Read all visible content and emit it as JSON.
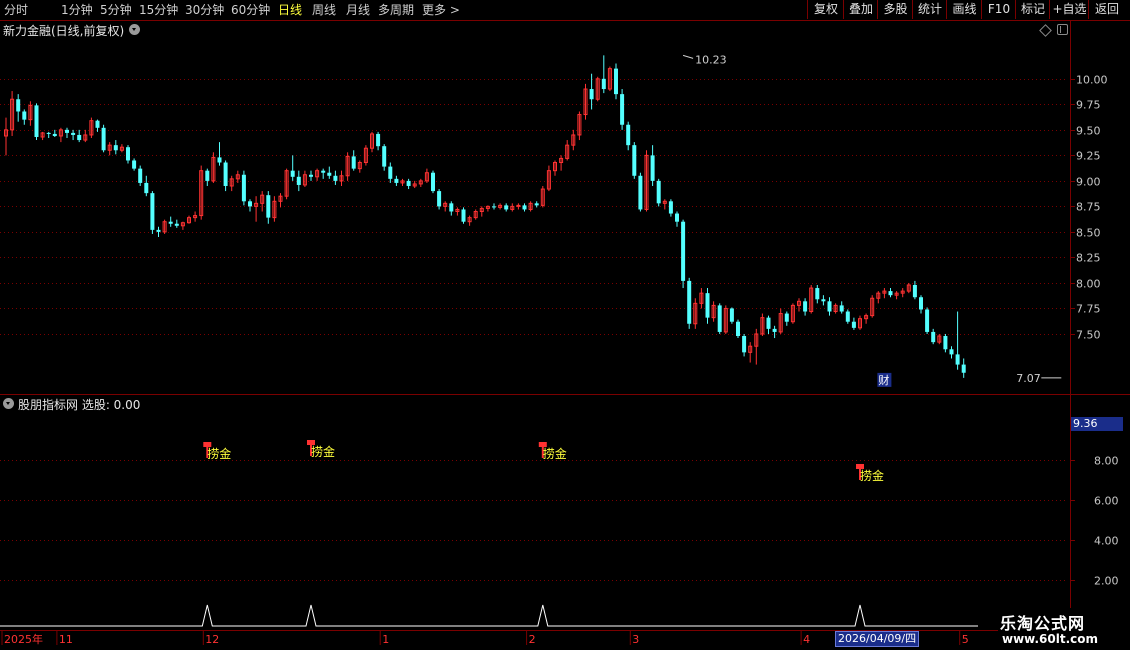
{
  "toolbar": {
    "periods": [
      "分时",
      "1分钟",
      "5分钟",
      "15分钟",
      "30分钟",
      "60分钟",
      "日线",
      "周线",
      "月线",
      "多周期",
      "更多 >"
    ],
    "active_period": "日线",
    "buttons": [
      "复权",
      "叠加",
      "多股",
      "统计",
      "画线",
      "F10",
      "标记",
      "+自选",
      "返回"
    ]
  },
  "price_panel": {
    "title": "新力金融(日线,前复权)"
  },
  "indicator_panel": {
    "title": "股朋指标网  选股: 0.00",
    "highlight_value": "9.36"
  },
  "brand": {
    "name": "乐淘公式网",
    "url": "www.60lt.com"
  },
  "colors": {
    "up": "#ff3232",
    "down": "#54ffff",
    "grid": "#7a0000",
    "axis_text": "#c8c8c8",
    "signal_text": "#ffff3c",
    "spike": "#ffffff"
  },
  "chart_data": [
    {
      "type": "candlestick",
      "ylim": [
        7.0,
        10.4
      ],
      "yticks": [
        7.5,
        7.75,
        8.0,
        8.25,
        8.5,
        8.75,
        9.0,
        9.25,
        9.5,
        9.75,
        10.0
      ],
      "annotations": [
        {
          "label": "10.23",
          "bar": 111,
          "value": 10.23
        },
        {
          "label": "7.07",
          "bar": 173,
          "value": 7.07
        },
        {
          "label": "财",
          "bar": 144,
          "value": 7.05
        }
      ],
      "candles": [
        [
          9.44,
          9.62,
          9.25,
          9.5
        ],
        [
          9.5,
          9.88,
          9.44,
          9.8
        ],
        [
          9.8,
          9.85,
          9.58,
          9.68
        ],
        [
          9.68,
          9.7,
          9.55,
          9.6
        ],
        [
          9.6,
          9.78,
          9.54,
          9.74
        ],
        [
          9.74,
          9.76,
          9.4,
          9.43
        ],
        [
          9.43,
          9.48,
          9.4,
          9.47
        ],
        [
          9.47,
          9.48,
          9.42,
          9.46
        ],
        [
          9.46,
          9.5,
          9.43,
          9.44
        ],
        [
          9.44,
          9.52,
          9.38,
          9.5
        ],
        [
          9.5,
          9.52,
          9.42,
          9.47
        ],
        [
          9.47,
          9.5,
          9.4,
          9.45
        ],
        [
          9.45,
          9.5,
          9.38,
          9.4
        ],
        [
          9.4,
          9.5,
          9.38,
          9.45
        ],
        [
          9.45,
          9.62,
          9.42,
          9.59
        ],
        [
          9.59,
          9.6,
          9.48,
          9.52
        ],
        [
          9.52,
          9.55,
          9.28,
          9.3
        ],
        [
          9.3,
          9.38,
          9.25,
          9.35
        ],
        [
          9.35,
          9.4,
          9.26,
          9.3
        ],
        [
          9.3,
          9.36,
          9.28,
          9.33
        ],
        [
          9.33,
          9.35,
          9.17,
          9.2
        ],
        [
          9.2,
          9.22,
          9.1,
          9.12
        ],
        [
          9.12,
          9.15,
          8.95,
          8.98
        ],
        [
          8.98,
          9.05,
          8.85,
          8.88
        ],
        [
          8.88,
          8.9,
          8.48,
          8.52
        ],
        [
          8.52,
          8.55,
          8.45,
          8.5
        ],
        [
          8.5,
          8.62,
          8.48,
          8.6
        ],
        [
          8.6,
          8.65,
          8.55,
          8.58
        ],
        [
          8.58,
          8.62,
          8.54,
          8.56
        ],
        [
          8.56,
          8.6,
          8.52,
          8.59
        ],
        [
          8.59,
          8.66,
          8.58,
          8.64
        ],
        [
          8.64,
          8.7,
          8.6,
          8.66
        ],
        [
          8.66,
          9.15,
          8.62,
          9.1
        ],
        [
          9.1,
          9.12,
          8.95,
          9.0
        ],
        [
          9.0,
          9.28,
          8.98,
          9.23
        ],
        [
          9.23,
          9.38,
          9.15,
          9.18
        ],
        [
          9.18,
          9.2,
          8.9,
          8.95
        ],
        [
          8.95,
          9.05,
          8.9,
          9.02
        ],
        [
          9.02,
          9.1,
          8.98,
          9.06
        ],
        [
          9.06,
          9.1,
          8.76,
          8.8
        ],
        [
          8.8,
          8.82,
          8.7,
          8.75
        ],
        [
          8.75,
          8.85,
          8.6,
          8.78
        ],
        [
          8.78,
          8.9,
          8.7,
          8.86
        ],
        [
          8.86,
          8.9,
          8.58,
          8.64
        ],
        [
          8.64,
          8.85,
          8.6,
          8.8
        ],
        [
          8.8,
          8.88,
          8.74,
          8.85
        ],
        [
          8.85,
          9.12,
          8.82,
          9.1
        ],
        [
          9.1,
          9.25,
          9.0,
          9.04
        ],
        [
          9.04,
          9.1,
          8.9,
          8.96
        ],
        [
          8.96,
          9.1,
          8.94,
          9.06
        ],
        [
          9.06,
          9.1,
          9.0,
          9.04
        ],
        [
          9.04,
          9.12,
          9.0,
          9.1
        ],
        [
          9.1,
          9.12,
          9.02,
          9.08
        ],
        [
          9.08,
          9.14,
          9.02,
          9.05
        ],
        [
          9.05,
          9.1,
          8.96,
          9.0
        ],
        [
          9.0,
          9.1,
          8.95,
          9.05
        ],
        [
          9.05,
          9.28,
          9.0,
          9.24
        ],
        [
          9.24,
          9.3,
          9.1,
          9.12
        ],
        [
          9.12,
          9.2,
          9.08,
          9.18
        ],
        [
          9.18,
          9.35,
          9.15,
          9.32
        ],
        [
          9.32,
          9.48,
          9.28,
          9.46
        ],
        [
          9.46,
          9.48,
          9.3,
          9.34
        ],
        [
          9.34,
          9.36,
          9.1,
          9.14
        ],
        [
          9.14,
          9.18,
          8.98,
          9.02
        ],
        [
          9.02,
          9.05,
          8.95,
          8.98
        ],
        [
          8.98,
          9.02,
          8.95,
          9.0
        ],
        [
          9.0,
          9.02,
          8.92,
          8.95
        ],
        [
          8.95,
          9.0,
          8.93,
          8.97
        ],
        [
          8.97,
          9.02,
          8.94,
          9.0
        ],
        [
          9.0,
          9.12,
          8.98,
          9.08
        ],
        [
          9.08,
          9.1,
          8.88,
          8.9
        ],
        [
          8.9,
          8.92,
          8.72,
          8.75
        ],
        [
          8.75,
          8.8,
          8.7,
          8.78
        ],
        [
          8.78,
          8.8,
          8.66,
          8.7
        ],
        [
          8.7,
          8.74,
          8.66,
          8.72
        ],
        [
          8.72,
          8.74,
          8.58,
          8.6
        ],
        [
          8.6,
          8.66,
          8.56,
          8.64
        ],
        [
          8.64,
          8.72,
          8.62,
          8.7
        ],
        [
          8.7,
          8.75,
          8.65,
          8.73
        ],
        [
          8.73,
          8.76,
          8.7,
          8.75
        ],
        [
          8.75,
          8.78,
          8.72,
          8.74
        ],
        [
          8.74,
          8.78,
          8.72,
          8.76
        ],
        [
          8.76,
          8.78,
          8.7,
          8.72
        ],
        [
          8.72,
          8.78,
          8.7,
          8.75
        ],
        [
          8.75,
          8.78,
          8.72,
          8.76
        ],
        [
          8.76,
          8.78,
          8.7,
          8.72
        ],
        [
          8.72,
          8.8,
          8.7,
          8.78
        ],
        [
          8.78,
          8.8,
          8.74,
          8.76
        ],
        [
          8.76,
          8.95,
          8.74,
          8.92
        ],
        [
          8.92,
          9.15,
          8.9,
          9.1
        ],
        [
          9.1,
          9.2,
          9.05,
          9.18
        ],
        [
          9.18,
          9.25,
          9.1,
          9.22
        ],
        [
          9.22,
          9.4,
          9.2,
          9.35
        ],
        [
          9.35,
          9.5,
          9.3,
          9.45
        ],
        [
          9.45,
          9.68,
          9.4,
          9.65
        ],
        [
          9.65,
          9.95,
          9.6,
          9.9
        ],
        [
          9.9,
          10.05,
          9.7,
          9.8
        ],
        [
          9.8,
          10.02,
          9.78,
          10.0
        ],
        [
          10.0,
          10.23,
          9.86,
          9.9
        ],
        [
          9.9,
          10.12,
          9.88,
          10.1
        ],
        [
          10.1,
          10.15,
          9.8,
          9.85
        ],
        [
          9.85,
          9.9,
          9.5,
          9.55
        ],
        [
          9.55,
          9.58,
          9.3,
          9.35
        ],
        [
          9.35,
          9.38,
          9.02,
          9.05
        ],
        [
          9.05,
          9.08,
          8.7,
          8.72
        ],
        [
          8.72,
          9.3,
          8.7,
          9.25
        ],
        [
          9.25,
          9.35,
          8.95,
          9.0
        ],
        [
          9.0,
          9.02,
          8.75,
          8.78
        ],
        [
          8.78,
          8.82,
          8.72,
          8.8
        ],
        [
          8.8,
          8.82,
          8.65,
          8.68
        ],
        [
          8.68,
          8.7,
          8.55,
          8.6
        ],
        [
          8.6,
          8.62,
          7.95,
          8.02
        ],
        [
          8.02,
          8.05,
          7.55,
          7.6
        ],
        [
          7.6,
          7.85,
          7.55,
          7.8
        ],
        [
          7.8,
          7.95,
          7.75,
          7.9
        ],
        [
          7.9,
          7.95,
          7.6,
          7.66
        ],
        [
          7.66,
          7.82,
          7.62,
          7.78
        ],
        [
          7.78,
          7.8,
          7.5,
          7.52
        ],
        [
          7.52,
          7.78,
          7.5,
          7.75
        ],
        [
          7.75,
          7.76,
          7.6,
          7.62
        ],
        [
          7.62,
          7.64,
          7.46,
          7.48
        ],
        [
          7.48,
          7.5,
          7.28,
          7.32
        ],
        [
          7.32,
          7.42,
          7.22,
          7.38
        ],
        [
          7.38,
          7.55,
          7.2,
          7.5
        ],
        [
          7.5,
          7.7,
          7.48,
          7.66
        ],
        [
          7.66,
          7.68,
          7.5,
          7.55
        ],
        [
          7.55,
          7.58,
          7.46,
          7.52
        ],
        [
          7.52,
          7.75,
          7.5,
          7.7
        ],
        [
          7.7,
          7.72,
          7.58,
          7.62
        ],
        [
          7.62,
          7.8,
          7.6,
          7.78
        ],
        [
          7.78,
          7.85,
          7.72,
          7.82
        ],
        [
          7.82,
          7.85,
          7.68,
          7.72
        ],
        [
          7.72,
          7.98,
          7.7,
          7.95
        ],
        [
          7.95,
          7.98,
          7.8,
          7.84
        ],
        [
          7.84,
          7.88,
          7.78,
          7.82
        ],
        [
          7.82,
          7.86,
          7.68,
          7.72
        ],
        [
          7.72,
          7.8,
          7.7,
          7.78
        ],
        [
          7.78,
          7.82,
          7.7,
          7.72
        ],
        [
          7.72,
          7.74,
          7.6,
          7.62
        ],
        [
          7.62,
          7.66,
          7.54,
          7.56
        ],
        [
          7.56,
          7.68,
          7.54,
          7.65
        ],
        [
          7.65,
          7.7,
          7.6,
          7.68
        ],
        [
          7.68,
          7.88,
          7.66,
          7.85
        ],
        [
          7.85,
          7.92,
          7.8,
          7.9
        ],
        [
          7.9,
          7.95,
          7.85,
          7.92
        ],
        [
          7.92,
          7.95,
          7.86,
          7.88
        ],
        [
          7.88,
          7.92,
          7.84,
          7.9
        ],
        [
          7.9,
          7.95,
          7.86,
          7.92
        ],
        [
          7.92,
          8.0,
          7.9,
          7.98
        ],
        [
          7.98,
          8.02,
          7.84,
          7.86
        ],
        [
          7.86,
          7.88,
          7.7,
          7.74
        ],
        [
          7.74,
          7.76,
          7.5,
          7.52
        ],
        [
          7.52,
          7.55,
          7.4,
          7.42
        ],
        [
          7.42,
          7.5,
          7.4,
          7.48
        ],
        [
          7.48,
          7.5,
          7.32,
          7.35
        ],
        [
          7.35,
          7.38,
          7.26,
          7.3
        ],
        [
          7.3,
          7.72,
          7.15,
          7.2
        ],
        [
          7.2,
          7.26,
          7.07,
          7.12
        ]
      ]
    },
    {
      "type": "signals",
      "ylim": [
        1.0,
        10.5
      ],
      "yticks": [
        2.0,
        4.0,
        6.0,
        8.0
      ],
      "signals": [
        {
          "bar": 33,
          "value": 8.3,
          "label": "捞金"
        },
        {
          "bar": 50,
          "value": 8.4,
          "label": "捞金"
        },
        {
          "bar": 88,
          "value": 8.3,
          "label": "捞金"
        },
        {
          "bar": 140,
          "value": 7.2,
          "label": "捞金"
        }
      ],
      "spikes": [
        33,
        50,
        88,
        140
      ]
    }
  ],
  "time_axis": {
    "labels": [
      {
        "text": "2025年",
        "bar": 0
      },
      {
        "text": "11",
        "bar": 9
      },
      {
        "text": "12",
        "bar": 33
      },
      {
        "text": "1",
        "bar": 62
      },
      {
        "text": "2",
        "bar": 86
      },
      {
        "text": "3",
        "bar": 103
      },
      {
        "text": "4",
        "bar": 131
      },
      {
        "text": "5",
        "bar": 157
      }
    ],
    "selected": {
      "text": "2026/04/09/四",
      "bar": 137
    }
  }
}
